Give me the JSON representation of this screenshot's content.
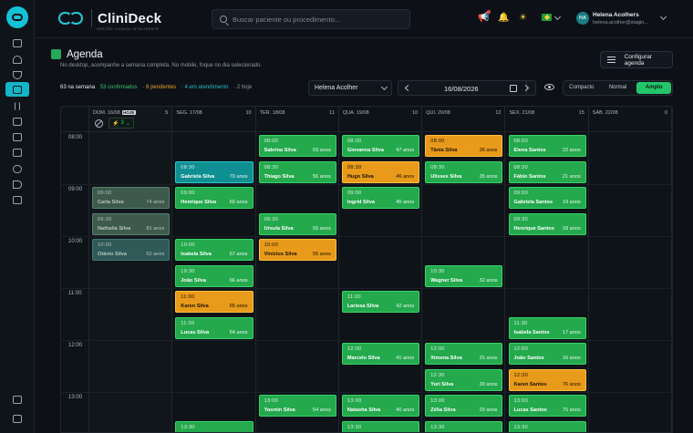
{
  "brand": {
    "name": "CliniDeck",
    "tagline": "GESTÃO CLÍNICA INTELIGENTE"
  },
  "search": {
    "placeholder": "Buscar paciente ou procedimento..."
  },
  "user": {
    "initials": "HA",
    "name": "Helena Acolhers",
    "email": "helena.acolher@stagin..."
  },
  "sidebar": {
    "items": [
      "grid-icon",
      "gauge-icon",
      "stethoscope-icon",
      "calendar-icon",
      "waveform-icon",
      "folder-icon",
      "wallet-icon",
      "chart-icon",
      "people-icon",
      "megaphone-icon",
      "building-icon"
    ],
    "bottom": [
      "profile-card-icon",
      "help-icon"
    ]
  },
  "page": {
    "title": "Agenda",
    "description": "No desktop, acompanhe a semana completa. No mobile, foque no dia selecionado.",
    "config_label": "Configurar agenda"
  },
  "stats": {
    "week": "63 na semana",
    "confirmed": "53 confirmados",
    "pending": "· 6 pendentes",
    "in_service": "· 4 em atendimento",
    "today": "· 2 hoje"
  },
  "filters": {
    "professional": "Helena Acolher",
    "date": "16/08/2026",
    "view_modes": [
      "Compacto",
      "Normal",
      "Amplo"
    ],
    "selected_view": "Amplo"
  },
  "colors": {
    "confirmed": "#24a94d",
    "pending": "#e89a1a",
    "in_service": "#0f8f91",
    "accent": "#22c56a",
    "brand": "#13c2d6"
  },
  "days": [
    {
      "label": "DOM. 16/08",
      "count": "5",
      "today_badge": "HOJE",
      "quick_count": "3"
    },
    {
      "label": "SEG. 17/08",
      "count": "10"
    },
    {
      "label": "TER. 18/08",
      "count": "11"
    },
    {
      "label": "QUA. 19/08",
      "count": "10"
    },
    {
      "label": "QUI. 20/08",
      "count": "12"
    },
    {
      "label": "SEX. 21/08",
      "count": "15"
    },
    {
      "label": "SÁB. 22/08",
      "count": "0"
    }
  ],
  "hours": [
    "08:00",
    "09:00",
    "10:00",
    "11:00",
    "12:00",
    "13:00"
  ],
  "appointments": [
    {
      "day": 0,
      "time": "09:00",
      "name": "Carla Silva",
      "age": "74 anos",
      "status": "past"
    },
    {
      "day": 0,
      "time": "09:30",
      "name": "Nathalia Silva",
      "age": "81 anos",
      "status": "past"
    },
    {
      "day": 0,
      "time": "10:00",
      "name": "Otávio Silva",
      "age": "62 anos",
      "status": "past-teal"
    },
    {
      "day": 1,
      "time": "08:30",
      "name": "Gabriela Silva",
      "age": "70 anos",
      "status": "in_service"
    },
    {
      "day": 1,
      "time": "09:00",
      "name": "Henrique Silva",
      "age": "69 anos",
      "status": "confirmed"
    },
    {
      "day": 1,
      "time": "10:00",
      "name": "Isabela Silva",
      "age": "67 anos",
      "status": "confirmed"
    },
    {
      "day": 1,
      "time": "10:30",
      "name": "João Silva",
      "age": "66 anos",
      "status": "confirmed"
    },
    {
      "day": 1,
      "time": "11:00",
      "name": "Karen Silva",
      "age": "65 anos",
      "status": "pending"
    },
    {
      "day": 1,
      "time": "11:30",
      "name": "Lucas Silva",
      "age": "64 anos",
      "status": "confirmed"
    },
    {
      "day": 1,
      "time": "13:30",
      "name": "",
      "age": "",
      "status": "confirmed"
    },
    {
      "day": 2,
      "time": "08:00",
      "name": "Sabrina Silva",
      "age": "59 anos",
      "status": "confirmed"
    },
    {
      "day": 2,
      "time": "08:30",
      "name": "Thiago Silva",
      "age": "56 anos",
      "status": "confirmed"
    },
    {
      "day": 2,
      "time": "09:30",
      "name": "Ursula Silva",
      "age": "56 anos",
      "status": "confirmed"
    },
    {
      "day": 2,
      "time": "10:00",
      "name": "Vinicius Silva",
      "age": "55 anos",
      "status": "pending"
    },
    {
      "day": 2,
      "time": "13:00",
      "name": "Yasmin Silva",
      "age": "54 anos",
      "status": "confirmed"
    },
    {
      "day": 3,
      "time": "08:00",
      "name": "Giovanna Silva",
      "age": "47 anos",
      "status": "confirmed"
    },
    {
      "day": 3,
      "time": "08:30",
      "name": "Hugo Silva",
      "age": "46 anos",
      "status": "pending"
    },
    {
      "day": 3,
      "time": "09:00",
      "name": "Ingrid Silva",
      "age": "45 anos",
      "status": "confirmed"
    },
    {
      "day": 3,
      "time": "11:00",
      "name": "Larissa Silva",
      "age": "42 anos",
      "status": "confirmed"
    },
    {
      "day": 3,
      "time": "12:00",
      "name": "Marcelo Silva",
      "age": "41 anos",
      "status": "confirmed"
    },
    {
      "day": 3,
      "time": "13:00",
      "name": "Natasha Silva",
      "age": "40 anos",
      "status": "confirmed"
    },
    {
      "day": 3,
      "time": "13:30",
      "name": "",
      "age": "",
      "status": "confirmed"
    },
    {
      "day": 4,
      "time": "08:00",
      "name": "Tânia Silva",
      "age": "36 anos",
      "status": "pending"
    },
    {
      "day": 4,
      "time": "08:30",
      "name": "Ulisses Silva",
      "age": "35 anos",
      "status": "confirmed"
    },
    {
      "day": 4,
      "time": "10:30",
      "name": "Wagner Silva",
      "age": "32 anos",
      "status": "confirmed"
    },
    {
      "day": 4,
      "time": "12:00",
      "name": "Ximena Silva",
      "age": "31 anos",
      "status": "confirmed"
    },
    {
      "day": 4,
      "time": "12:30",
      "name": "Yuri Silva",
      "age": "30 anos",
      "status": "confirmed"
    },
    {
      "day": 4,
      "time": "13:00",
      "name": "Zélia Silva",
      "age": "29 anos",
      "status": "confirmed"
    },
    {
      "day": 4,
      "time": "13:30",
      "name": "",
      "age": "",
      "status": "confirmed"
    },
    {
      "day": 5,
      "time": "08:00",
      "name": "Elena Santos",
      "age": "22 anos",
      "status": "confirmed"
    },
    {
      "day": 5,
      "time": "08:30",
      "name": "Fábio Santos",
      "age": "21 anos",
      "status": "confirmed"
    },
    {
      "day": 5,
      "time": "09:00",
      "name": "Gabriela Santos",
      "age": "19 anos",
      "status": "confirmed"
    },
    {
      "day": 5,
      "time": "09:30",
      "name": "Henrique Santos",
      "age": "18 anos",
      "status": "confirmed"
    },
    {
      "day": 5,
      "time": "11:30",
      "name": "Isabela Santos",
      "age": "17 anos",
      "status": "confirmed"
    },
    {
      "day": 5,
      "time": "12:00",
      "name": "João Santos",
      "age": "16 anos",
      "status": "confirmed"
    },
    {
      "day": 5,
      "time": "12:30",
      "name": "Karen Santos",
      "age": "76 anos",
      "status": "pending"
    },
    {
      "day": 5,
      "time": "13:00",
      "name": "Lucas Santos",
      "age": "75 anos",
      "status": "confirmed"
    },
    {
      "day": 5,
      "time": "13:30",
      "name": "",
      "age": "",
      "status": "confirmed"
    }
  ]
}
